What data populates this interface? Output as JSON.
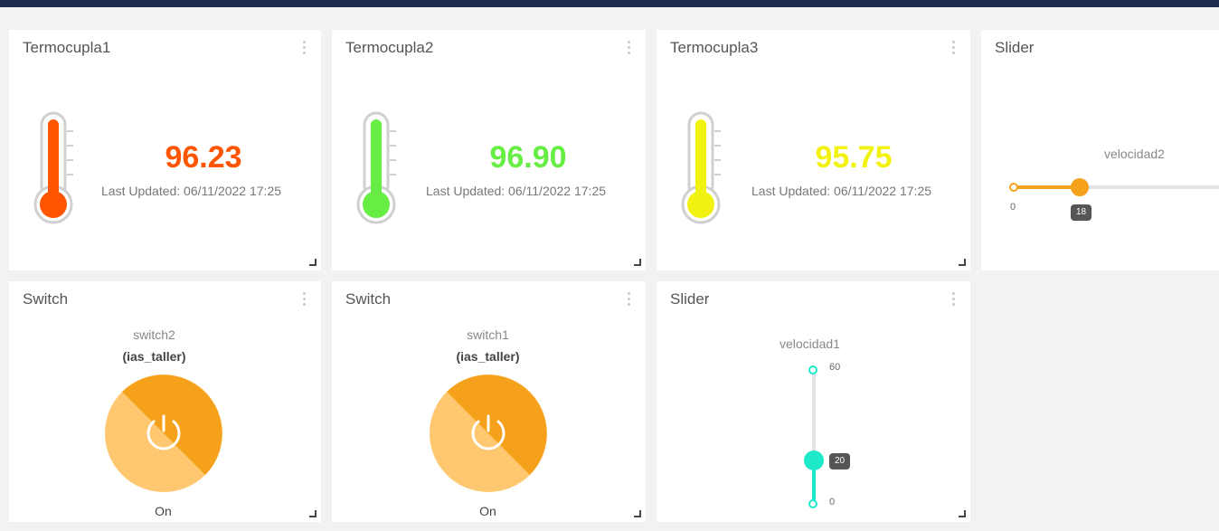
{
  "thermocouples": [
    {
      "title": "Termocupla1",
      "value": "96.23",
      "updated": "Last Updated: 06/11/2022 17:25",
      "color": "#ff5500"
    },
    {
      "title": "Termocupla2",
      "value": "96.90",
      "updated": "Last Updated: 06/11/2022 17:25",
      "color": "#66ee44"
    },
    {
      "title": "Termocupla3",
      "value": "95.75",
      "updated": "Last Updated: 06/11/2022 17:25",
      "color": "#f2f211"
    }
  ],
  "slider_h": {
    "title": "Slider",
    "label": "velocidad2",
    "min": "0",
    "value": "18",
    "max": 60,
    "color": "#f6a11b"
  },
  "switches": [
    {
      "title": "Switch",
      "name": "switch2",
      "device": "(ias_taller)",
      "state": "On"
    },
    {
      "title": "Switch",
      "name": "switch1",
      "device": "(ias_taller)",
      "state": "On"
    }
  ],
  "slider_v": {
    "title": "Slider",
    "label": "velocidad1",
    "max": "60",
    "min": "0",
    "value": "20",
    "color": "#1de9c8"
  },
  "colors": {
    "switch_dark": "#f6a11b",
    "switch_light": "#ffc870",
    "header": "#1b2a4e"
  }
}
